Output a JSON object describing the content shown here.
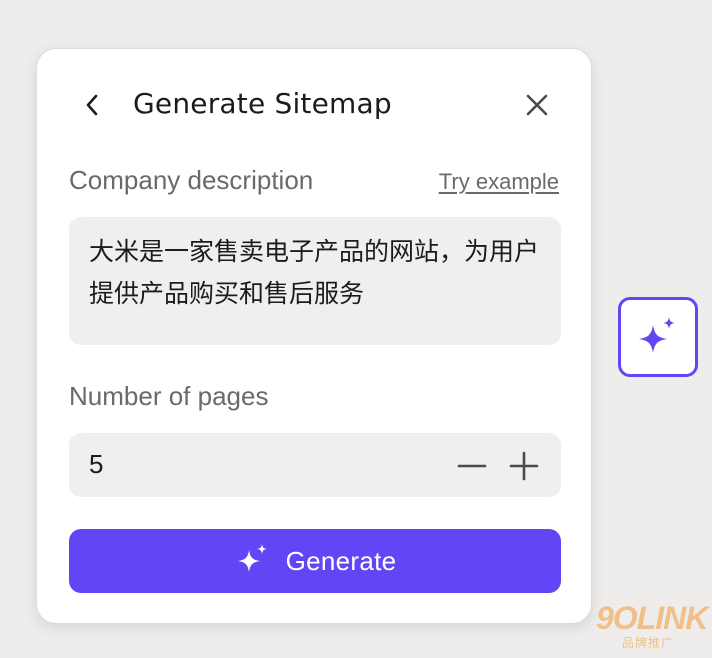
{
  "dialog": {
    "title": "Generate Sitemap",
    "company_label": "Company description",
    "try_example": "Try example",
    "description_value": "大米是一家售卖电子产品的网站，为用户提供产品购买和售后服务",
    "pages_label": "Number of pages",
    "pages_value": "5",
    "generate_label": "Generate"
  },
  "icons": {
    "back": "chevron-left-icon",
    "close": "close-icon",
    "minus": "minus-icon",
    "plus": "plus-icon",
    "generate": "sparkle-icon",
    "fab": "sparkle-icon"
  },
  "colors": {
    "accent": "#6046f5",
    "background": "#eeedec",
    "panel": "#ffffff",
    "field": "#f0efee",
    "text": "#1c1c1c",
    "muted": "#6a6a6a"
  },
  "watermark": {
    "brand": "9OLINK",
    "tagline": "品牌推广"
  }
}
